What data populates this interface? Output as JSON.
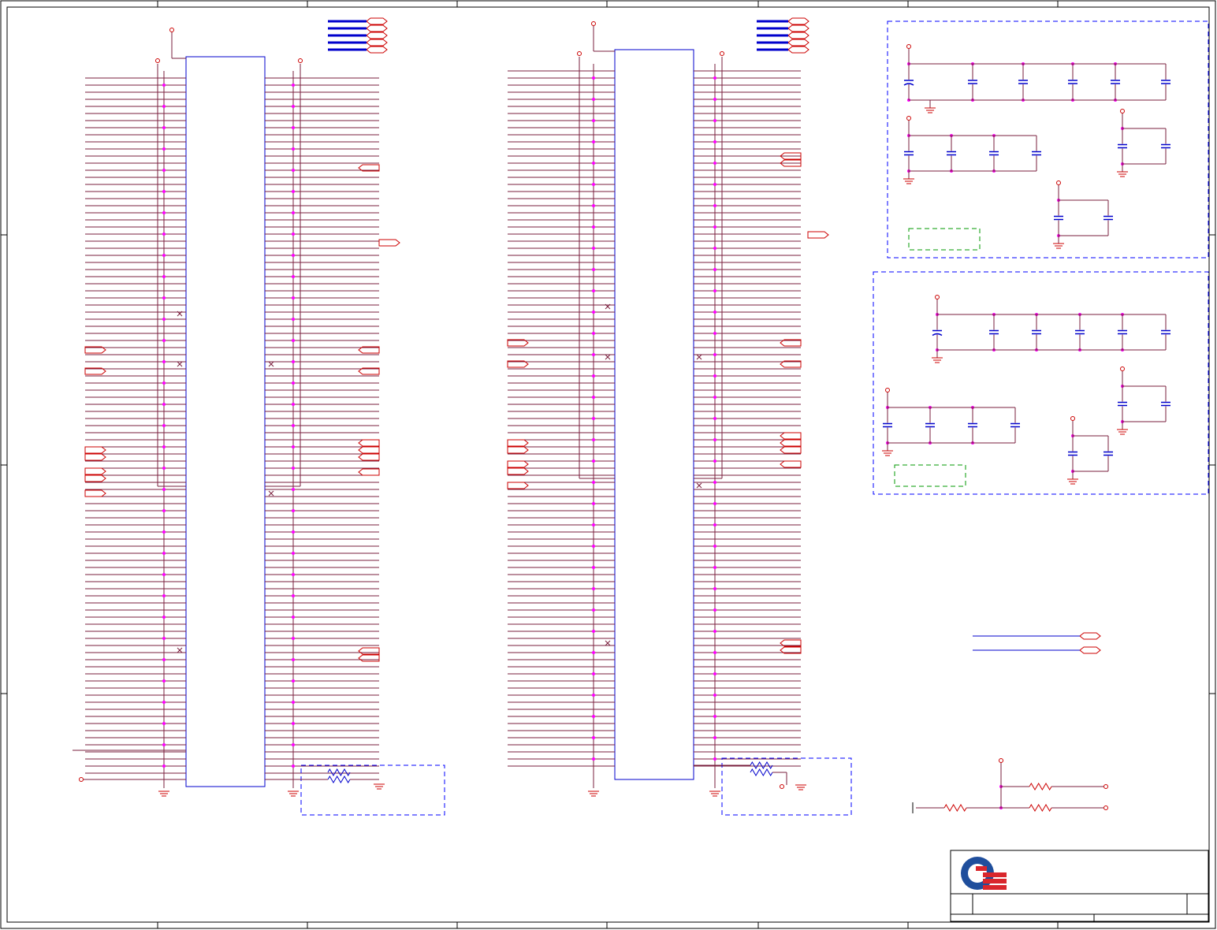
{
  "sheet": {
    "title": "",
    "border_color": "#000000",
    "wire_color": "#7a1f3d",
    "bus_color": "#0000cc",
    "power_color": "#cc0000",
    "junction_color": "#ff00ff",
    "dashed_box_color": "#0000ff",
    "note_box_color": "#009900"
  },
  "connectors": [
    {
      "name": "left-slot-connector"
    },
    {
      "name": "right-slot-connector"
    }
  ],
  "decoupling_groups": [
    {
      "name": "upper-decoupling-group"
    },
    {
      "name": "lower-decoupling-group"
    }
  ],
  "title_block": {
    "logo": "company-logo",
    "logo_colors": {
      "ring": "#1f4e9c",
      "stripes": "#d9262c"
    }
  },
  "icons": [
    "ground-icon",
    "power-pin-icon",
    "off-page-connector-icon",
    "resistor-icon",
    "capacitor-icon",
    "junction-dot-icon",
    "no-connect-icon"
  ]
}
